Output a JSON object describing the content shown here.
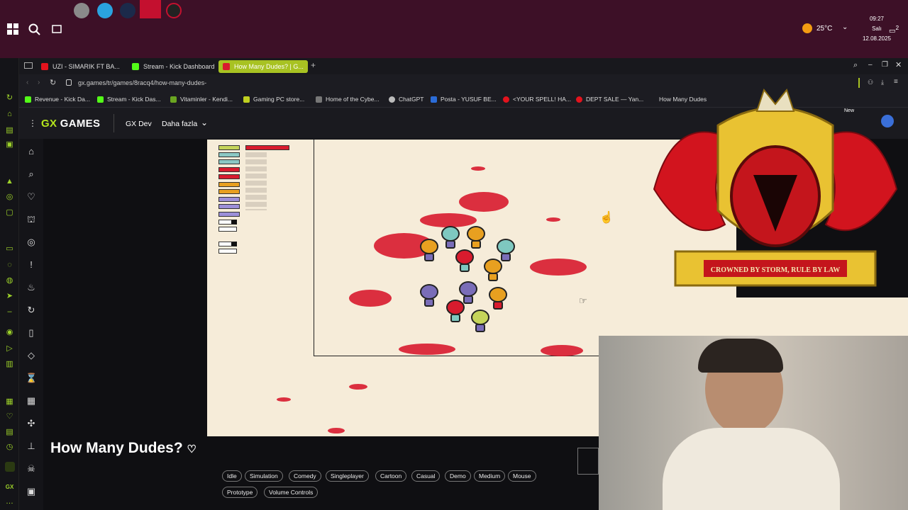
{
  "taskbar": {
    "weather": "25°C",
    "clock": {
      "time": "09:27",
      "day": "Salı",
      "date": "12.08.2025"
    },
    "notification_count": "2"
  },
  "browser": {
    "tabs": [
      {
        "label": "UZI - SIMARIK FT BA...",
        "color": "#e3131d"
      },
      {
        "label": "Stream - Kick Dashboard",
        "color": "#53fc18"
      },
      {
        "label": "How Many Dudes? | G...",
        "color": "#a8c222"
      }
    ],
    "url": "gx.games/tr/games/8racq4/how-many-dudes-",
    "bookmarks": [
      "Revenue - Kick Da...",
      "Stream - Kick Das...",
      "Vitaminler - Kendi...",
      "Gaming PC store...",
      "Home of the Cybe...",
      "ChatGPT",
      "Posta - YUSUF BE...",
      "<YOUR SPELL! HA...",
      "DEPT SALE — Yan...",
      "How Many Dudes"
    ],
    "new_badge": "New"
  },
  "gx": {
    "logo_gx": "GX",
    "logo_games": " GAMES",
    "nav": [
      "GX Dev",
      "Daha fazla"
    ]
  },
  "game": {
    "title": "How Many Dudes?",
    "tags": [
      "Idle",
      "Simulation",
      "Comedy",
      "Singleplayer",
      "Cartoon",
      "Casual",
      "Demo",
      "Medium",
      "Mouse",
      "Prototype",
      "Volume Controls"
    ]
  },
  "overlay": {
    "crest_motto": "CROWNED BY STORM, RULE BY LAW"
  },
  "colors": {
    "accent": "#a8c222",
    "blood": "#d81b2e",
    "game_bg": "#f6ecd9"
  }
}
